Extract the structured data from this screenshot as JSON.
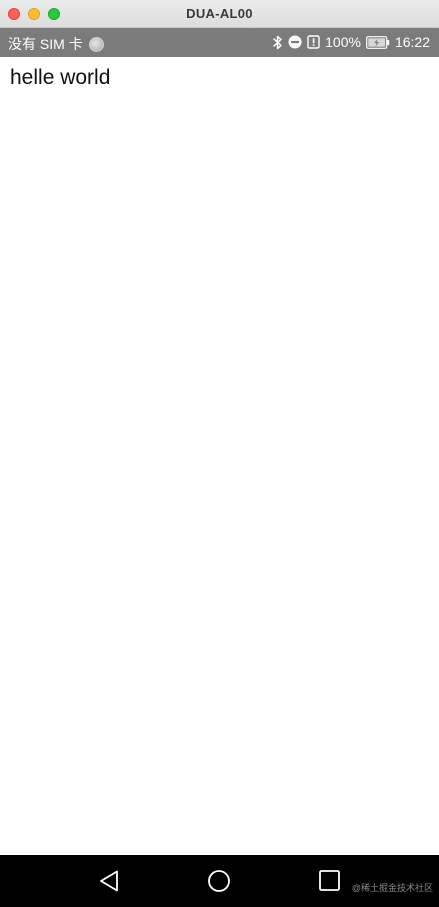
{
  "window": {
    "title": "DUA-AL00"
  },
  "status_bar": {
    "carrier": "没有 SIM 卡",
    "battery_percent": "100%",
    "time": "16:22",
    "icons": [
      "sync-icon",
      "bluetooth-icon",
      "do-not-disturb-icon",
      "alert-icon",
      "battery-icon"
    ]
  },
  "content": {
    "text": "helle world"
  },
  "nav_bar": {
    "buttons": [
      "back-icon",
      "home-icon",
      "recents-icon"
    ]
  },
  "watermark": {
    "text": "@稀土掘金技术社区"
  }
}
